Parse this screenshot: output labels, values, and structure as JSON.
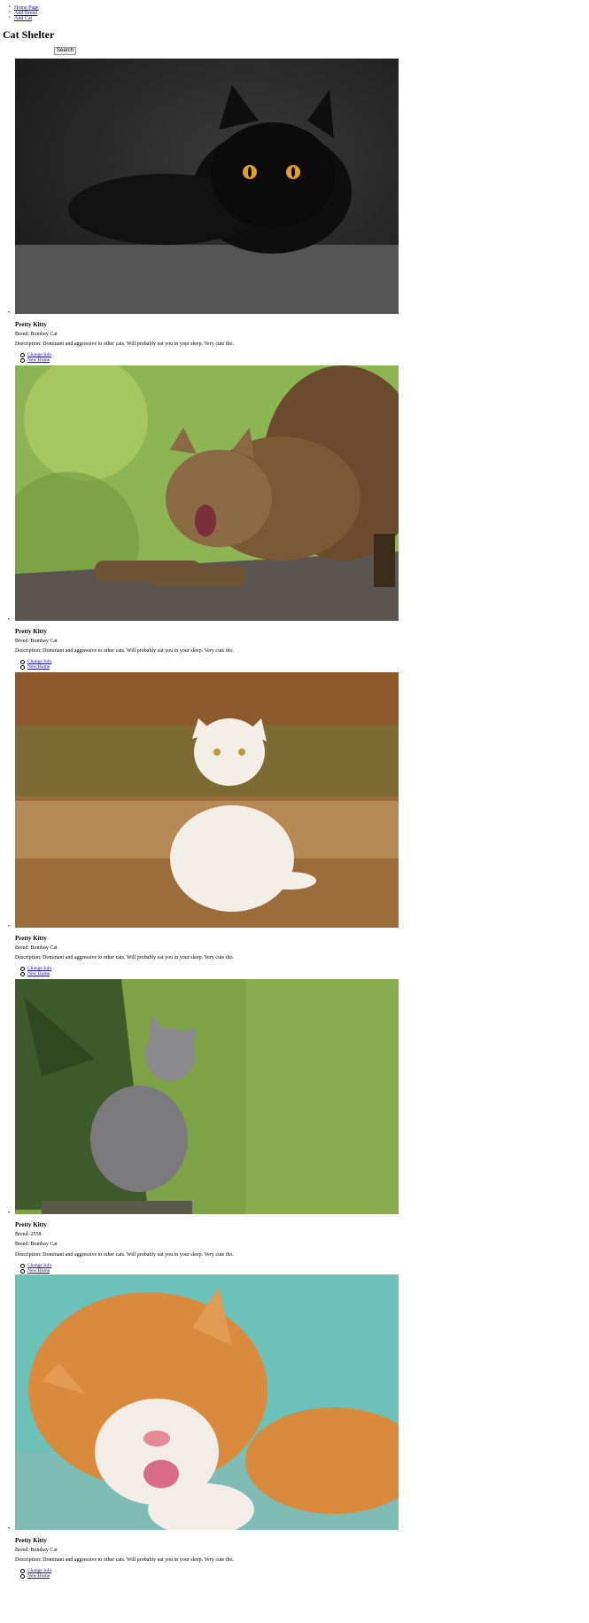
{
  "nav": {
    "items": [
      {
        "label": "Home Page"
      },
      {
        "label": "Add Breed"
      },
      {
        "label": "Add Cat"
      }
    ]
  },
  "page": {
    "title": "Cat Shelter"
  },
  "search": {
    "button_label": "Search",
    "value": ""
  },
  "cats": [
    {
      "name": "Pretty Kitty",
      "breed": "Breed: Bombay Cat",
      "description": "Description: Dominant and aggressive to other cats. Will probably eat you in your sleep. Very cute tho.",
      "links": {
        "change": "Change Info",
        "shelter": "New Home"
      },
      "photo": {
        "subject": "black-cat",
        "colors": {
          "bg": "#1c1c1c",
          "fur": "#0e0e0e",
          "eyes": "#e2a028"
        }
      }
    },
    {
      "name": "Pretty Kitty",
      "breed": "Breed: Bombay Cat",
      "description": "Description: Dominant and aggressive to other cats. Will probably eat you in your sleep. Very cute tho.",
      "links": {
        "change": "Change Info",
        "shelter": "New Home"
      },
      "photo": {
        "subject": "tabby-cat-stretching",
        "colors": {
          "bg": "#8eb554",
          "fur": "#7a5a36",
          "wood": "#5a5550"
        }
      }
    },
    {
      "name": "Pretty Kitty",
      "breed": "Breed: Bombay Cat",
      "description": "Description: Dominant and aggressive to other cats. Will probably eat you in your sleep. Very cute tho.",
      "links": {
        "change": "Change Info",
        "shelter": "New Home"
      },
      "photo": {
        "subject": "white-cat-autumn",
        "colors": {
          "bg": "#9a6a3a",
          "fur": "#f3efe6",
          "ground": "#b58a55"
        }
      }
    },
    {
      "name": "Pretty Kitty",
      "breed": "Breed: 2558",
      "description": "Description: Dominant and aggressive to other cats. Will probably eat you in your sleep. Very cute tho.",
      "links": {
        "change": "Change Info",
        "shelter": "New Home"
      },
      "photo": {
        "subject": "grey-kitten",
        "colors": {
          "bg": "#7ea346",
          "fur": "#7b7b7d",
          "tree": "#3d5a2a"
        }
      }
    },
    {
      "name": "Pretty Kitty",
      "breed": "Breed: Bombay Cat",
      "description": "Description: Dominant and aggressive to other cats. Will probably eat you in your sleep. Very cute tho.",
      "links": {
        "change": "Change Info",
        "shelter": "New Home"
      },
      "photo": {
        "subject": "orange-cat-licking",
        "colors": {
          "bg": "#6cc2b9",
          "fur": "#d98a3c",
          "white": "#f2ede6"
        }
      }
    }
  ],
  "extra_line": "Breed: Bombay Cat"
}
